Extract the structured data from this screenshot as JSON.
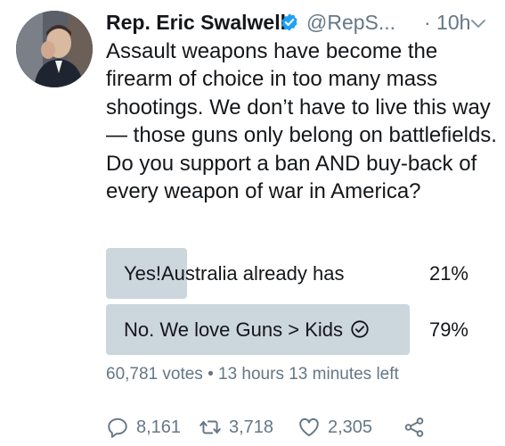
{
  "tweet": {
    "author_name": "Rep. Eric Swalwell",
    "handle": "@RepS...",
    "time": "· 10h",
    "text": "Assault weapons have become the firearm of choice in too many mass shootings. We don’t have to live this way — those guns only belong on battlefields. Do you support a ban AND buy-back of every weapon of war in America?",
    "icons": {
      "verified": "verified-badge-icon",
      "menu": "chevron-down-icon"
    },
    "colors": {
      "verified": "#1da1f2",
      "poll_bar": "#ccd6dd",
      "muted": "#657786"
    }
  },
  "poll": {
    "options": [
      {
        "label": "Yes!Australia already has",
        "percent_text": "21%",
        "percent": 21,
        "selected": false
      },
      {
        "label": "No. We love Guns > Kids",
        "percent_text": "79%",
        "percent": 79,
        "selected": true
      }
    ],
    "meta": "60,781 votes • 13 hours 13 minutes left"
  },
  "actions": {
    "replies": "8,161",
    "retweets": "3,718",
    "likes": "2,305"
  }
}
